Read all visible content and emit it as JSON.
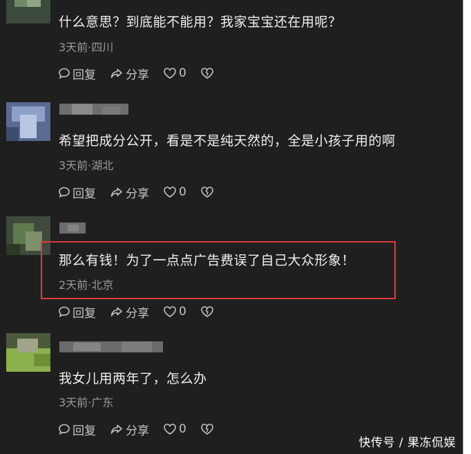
{
  "comments": [
    {
      "text": "什么意思？到底能不能用？我家宝宝还在用呢？",
      "meta": "3天前·四川",
      "reply_label": "回复",
      "share_label": "分享",
      "like_count": "0"
    },
    {
      "text": "希望把成分公开，看是不是纯天然的，全是小孩子用的啊",
      "meta": "3天前·湖北",
      "reply_label": "回复",
      "share_label": "分享",
      "like_count": "0"
    },
    {
      "text": "那么有钱！为了一点点广告费误了自己大众形象！",
      "meta": "2天前·北京",
      "reply_label": "回复",
      "share_label": "分享",
      "like_count": "0"
    },
    {
      "text": "我女儿用两年了，怎么办",
      "meta": "3天前·广东",
      "reply_label": "回复",
      "share_label": "分享",
      "like_count": "0"
    }
  ],
  "watermark": "快传号 / 果冻侃娱",
  "colors": {
    "background": "#1f1f1f",
    "highlight_border": "#e23a3a",
    "meta_text": "#9a9a9a",
    "comment_text": "#f0f0f0"
  },
  "icons": [
    "reply-icon",
    "share-icon",
    "like-heart-icon",
    "dislike-heart-icon"
  ]
}
